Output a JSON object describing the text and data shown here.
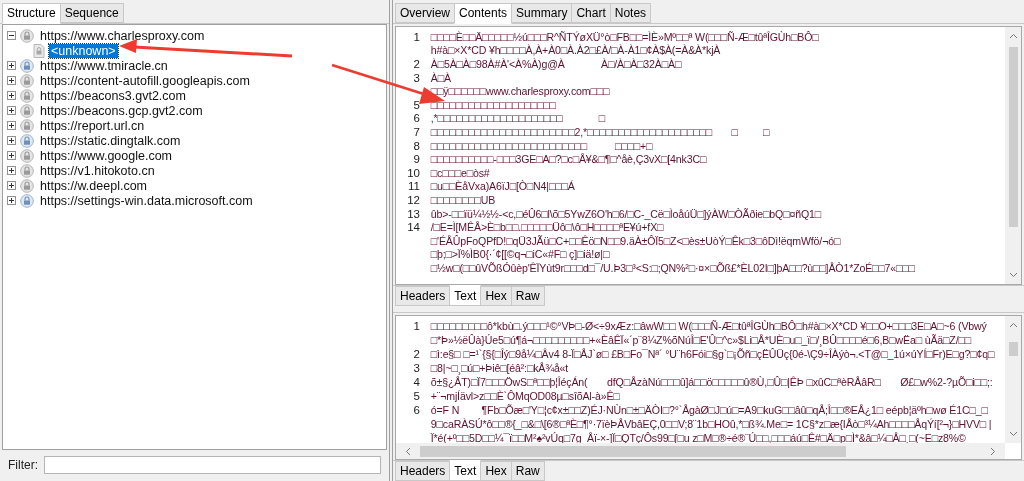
{
  "left_panel": {
    "tabs": [
      {
        "label": "Structure",
        "selected": true
      },
      {
        "label": "Sequence",
        "selected": false
      }
    ],
    "tree": [
      {
        "label": "https://www.charlesproxy.com",
        "kind": "lock",
        "expanded": true,
        "selected": false,
        "children": [
          {
            "label": "<unknown>",
            "kind": "document",
            "selected": true
          }
        ]
      },
      {
        "label": "https://www.tmiracle.cn",
        "kind": "globe",
        "expanded": false,
        "selected": false
      },
      {
        "label": "https://content-autofill.googleapis.com",
        "kind": "lock",
        "expanded": false,
        "selected": false
      },
      {
        "label": "https://beacons3.gvt2.com",
        "kind": "lock",
        "expanded": false,
        "selected": false
      },
      {
        "label": "https://beacons.gcp.gvt2.com",
        "kind": "lock",
        "expanded": false,
        "selected": false
      },
      {
        "label": "https://report.url.cn",
        "kind": "lock",
        "expanded": false,
        "selected": false
      },
      {
        "label": "https://static.dingtalk.com",
        "kind": "globe",
        "expanded": false,
        "selected": false
      },
      {
        "label": "https://www.google.com",
        "kind": "lock",
        "expanded": false,
        "selected": false
      },
      {
        "label": "https://v1.hitokoto.cn",
        "kind": "lock",
        "expanded": false,
        "selected": false
      },
      {
        "label": "https://w.deepl.com",
        "kind": "lock",
        "expanded": false,
        "selected": false
      },
      {
        "label": "https://settings-win.data.microsoft.com",
        "kind": "globe",
        "expanded": false,
        "selected": false
      }
    ],
    "filter": {
      "label": "Filter:"
    }
  },
  "right_panel": {
    "tabs": [
      {
        "label": "Overview",
        "selected": false
      },
      {
        "label": "Contents",
        "selected": true
      },
      {
        "label": "Summary",
        "selected": false
      },
      {
        "label": "Chart",
        "selected": false
      },
      {
        "label": "Notes",
        "selected": false
      }
    ],
    "request": {
      "lines": [
        {
          "number": "1",
          "text": "□□□□È□□Ä□□□□□½ú□□□R^ÑTÝøXÜ°ò□FB□□=ÌÈ»Mº□□ª W(□□□Ñ-Æ□tûªÎGÙh□BÔ□"
        },
        {
          "text": "h#à□×X*CD ¥h□□□□À,À+À0□À.À2□£À/□À-À1□¢À$À(=À&À*kjÀ"
        },
        {
          "number": "2",
          "text": "À□5À□À□98À#À'<À%À)g@À             À□/À□À□32À□À□"
        },
        {
          "number": "3",
          "text": "À□À"
        },
        {
          "text": "□□ÿ□□□□□□www.charlesproxy.com□□□"
        },
        {
          "number": "5",
          "text": "□□□□□□□□□□□□□□□□□□□□"
        },
        {
          "number": "6",
          "text": ",*□□□□□□□□□□□□□□□□□□□□             □"
        },
        {
          "number": "7",
          "text": "□□□□□□□□□□□□□□□□□□□□□□□2,*□□□□□□□□□□□□□□□□□□□□       □         □"
        },
        {
          "number": "8",
          "text": "□□□□□□□□□□□□□□□□□□□□□□□□□          □□□□+□"
        },
        {
          "number": "9",
          "text": "□□□□□□□□□□-□□□3GE□A□?□c□Å¥&□¶□^åè,Ç3vX□[4nk3C□"
        },
        {
          "number": "10",
          "text": "□c□□□e□òs#"
        },
        {
          "number": "11",
          "text": "□u□□ÈåVxa)A6ïJ□[Ò□N4|□□□Á"
        },
        {
          "number": "12",
          "text": "□□□□□□□□UB"
        },
        {
          "number": "13",
          "text": "ûb>-□□ïü¼½½-<c,□éÛ6□l\\õ□5YwZ6O'h□6/□C-_Cë□ÌoåúÜ□]ýÀW□ÒÃðie□bQ□¤ñQ1□"
        },
        {
          "number": "14",
          "text": "/□E=Ì[MÊÅ>È□b□□.□□□□□Üô□\\ô□H□□□□ªE¥ú+fX□"
        },
        {
          "text": "□'ÉÅÛpFoQPfD!□qÜ3JÃü□C+□□Êö□N□□9.äÀ±ÔÏ5□Z<□ès±UòÝ□Êk□3□ôDì!ëqmWfö/¬ó□"
        },
        {
          "text": "□þ;□>Ï%ÌB0{·´¢[[©q¬□iC«#F□ ç]□iä!ø|□"
        },
        {
          "text": "□½w□(□□ûVÕßÓûèp'ÊÏYùt9r□□□d□¯/U.Þ3□³<S:□;QN%²□·¤×□Õß£*ÈL02I□]þA□□?ù□□]ÅÒ1*ZoÉ□□7«□□□"
        }
      ],
      "tabs": [
        {
          "label": "Headers",
          "selected": false
        },
        {
          "label": "Text",
          "selected": true
        },
        {
          "label": "Hex",
          "selected": false
        },
        {
          "label": "Raw",
          "selected": false
        }
      ]
    },
    "response": {
      "lines": [
        {
          "number": "1",
          "text": "□□□□□□□□□ô*kbù□.ý□□□¹©°VÞ□-Ø<÷9xÆz:□âwW□□ W(□□□Ñ-Æ□tûªÎGÙh□BÔ□h#à□×X*CD ¥□□O+□□□3E□A□~6 (Vbwý"
        },
        {
          "text": "□*Þ»½ëÛà}Úe5□ú¶á¬□□□□□□□□□+«ÈâÊÏ«´p¨8¼Z%õNúÎ□E'Û□^c»$Li□Å*UÈ□u□_ï□/¸BÛ□□□□é□6,B□wËa□ ùÃä□Z/□□"
        },
        {
          "number": "2",
          "text": "□ì:e§□ □=¹`{§{□Îý□9å¼□Âv4 8-Ï□ÅJ`ø□ £B□Fo¯Nª´ °U¨h6Fói□§g`□¡Õñ□çËÛÜç{0é-\\Ç9÷ÎÀýò¬.<T@□_1ú×úYÍ□Fr)E□g?□¢q□"
        },
        {
          "number": "3",
          "text": "□8|~□¸□ú□+Þiê□[éâ²:□kÅ¾å«t"
        },
        {
          "number": "4",
          "text": "õ±§¿ÅT)□Ï7□□□ÖwS□ª□□þ¦ÎéçÁn(       dfQ□ÅzàNú□□□û]á□□ö□□□□□û®Ù,□Û□|ÊÞ □xûC□ªèRÅâR□       Ø£□w%2-?µÕ□i□□;:"
        },
        {
          "number": "5",
          "text": "+¨¬mjÍävl>z□□È`ÔMqOD08µ□sîõAl-à»Ê□"
        },
        {
          "number": "6",
          "text": "ó=F N        ¶Fb□Õæ□'Y□¦c¢x±□□Z)ÉJ·NÙn□±□ÄÒI□?°`ÅgàØ□J□ú□=A9□kuG□□âû□qÅ;Î□□®EÅ¿1□ eépb¦äºh□wø É1C□_□"
        },
        {
          "text": "9□caRÀSÚ*ô□□®{_□&□\\[6®□ªÈ□¶°·7ïèÞÅVbâEÇ,0□□V;8¨1b□HOû,*□ß¾.Me□= 1C§*z□æ{IÅò□³¼Ah□□□□ÅqÝí[²¬}□HVV□ |"
        },
        {
          "text": "Ï*é(+º□□5D□□¼¯ï□□M²♠²vÚq□7g  Åï-×-]Ï□QTç/Ôs99□[□u z□M□®÷é®¨Ú□□,□□□áú□Ê#□Ä□p□Ì*&â□¼□Å□¸□(~E□z8%©"
        }
      ],
      "tabs": [
        {
          "label": "Headers",
          "selected": false
        },
        {
          "label": "Text",
          "selected": true
        },
        {
          "label": "Hex",
          "selected": false
        },
        {
          "label": "Raw",
          "selected": false
        }
      ]
    }
  }
}
